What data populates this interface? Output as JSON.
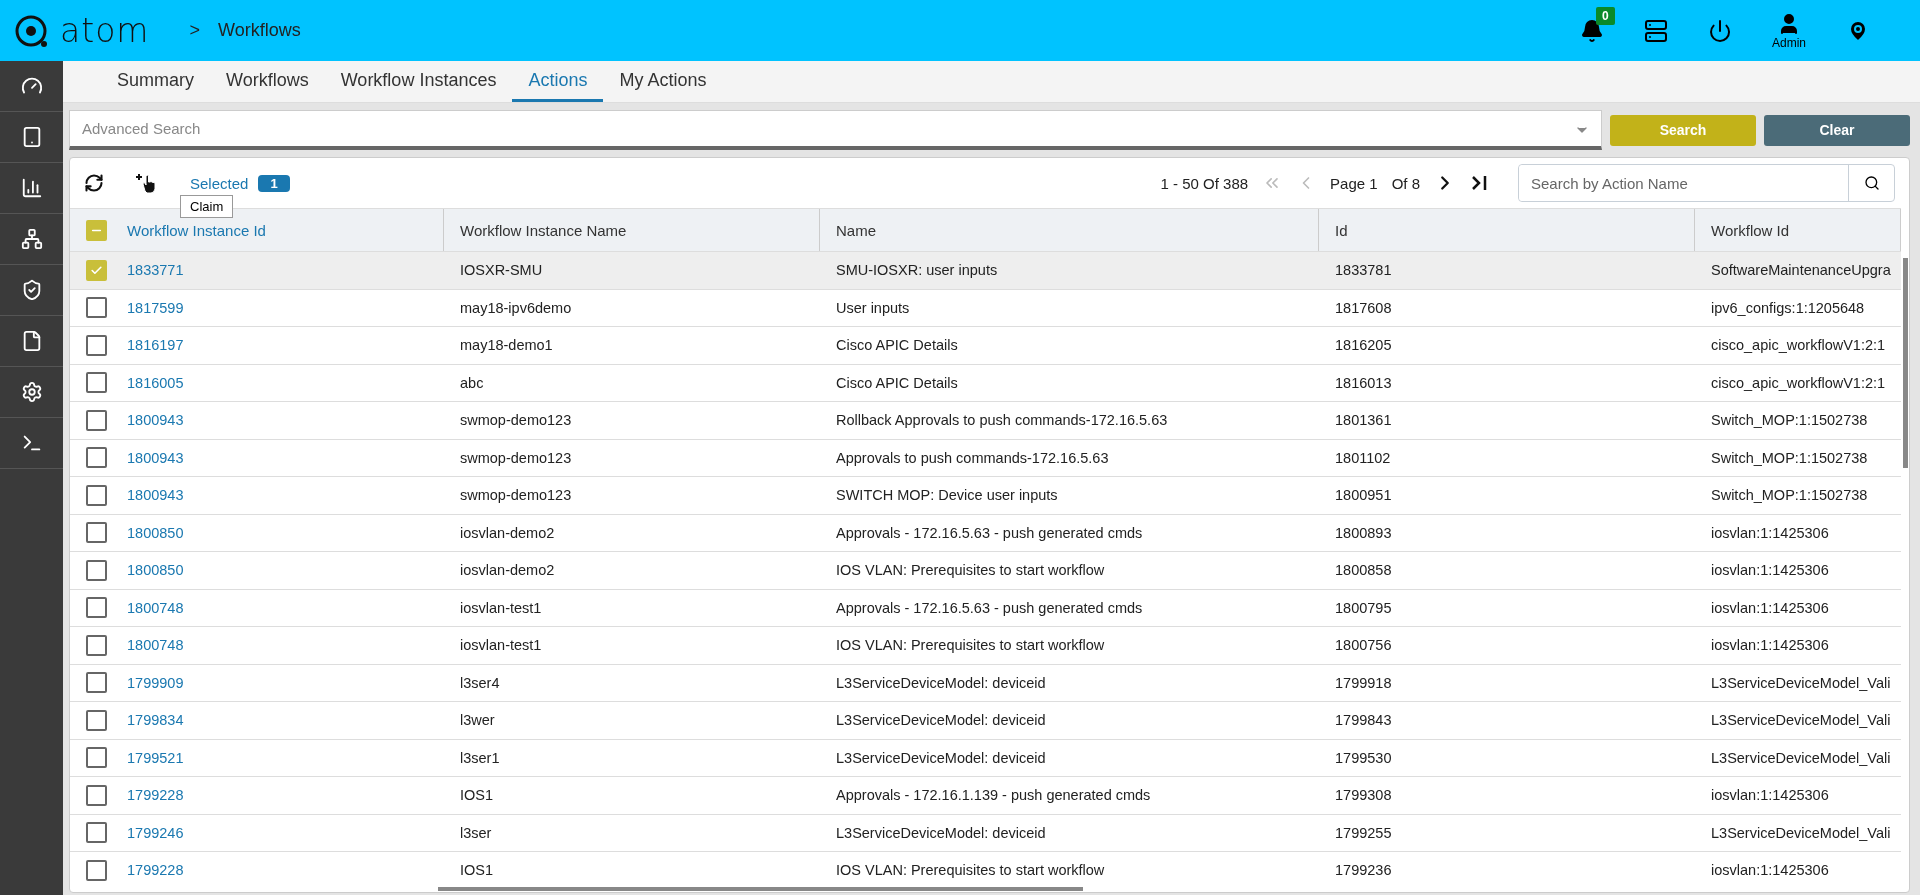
{
  "header": {
    "logo": "atom",
    "breadcrumb_separator": ">",
    "breadcrumb": "Workflows",
    "notifications": "0",
    "user": "Admin"
  },
  "sidebar": {
    "items": [
      {
        "kind": "dashboard",
        "selected": false
      },
      {
        "kind": "devices",
        "selected": false
      },
      {
        "kind": "charts",
        "selected": false
      },
      {
        "kind": "network",
        "selected": false
      },
      {
        "kind": "shield",
        "selected": false
      },
      {
        "kind": "file",
        "selected": false
      },
      {
        "kind": "settings",
        "selected": false
      },
      {
        "kind": "terminal",
        "selected": false
      }
    ]
  },
  "tabs": [
    {
      "label": "Summary",
      "selected": false
    },
    {
      "label": "Workflows",
      "selected": false
    },
    {
      "label": "Workflow Instances",
      "selected": false
    },
    {
      "label": "Actions",
      "selected": true
    },
    {
      "label": "My Actions",
      "selected": false
    }
  ],
  "advanced_search": {
    "placeholder": "Advanced Search"
  },
  "buttons": [
    {
      "label": "Search",
      "kind": "primary"
    },
    {
      "label": "Clear",
      "kind": "secondary"
    }
  ],
  "toolbar": {
    "selected_label": "Selected",
    "selected_count": "1",
    "tooltip": "Claim",
    "range": "1 - 50 Of 388",
    "page": "Page 1",
    "of_pages": "Of 8",
    "search_placeholder": "Search by Action Name"
  },
  "table": {
    "select_all_partial": true,
    "columns": [
      "Workflow Instance Id",
      "Workflow Instance Name",
      "Name",
      "Id",
      "Workflow Id"
    ],
    "rows": [
      {
        "selected": true,
        "cells": [
          "1833771",
          "IOSXR-SMU",
          "SMU-IOSXR: user inputs",
          "1833781",
          "SoftwareMaintenanceUpgra"
        ]
      },
      {
        "selected": false,
        "cells": [
          "1817599",
          "may18-ipv6demo",
          "User inputs",
          "1817608",
          "ipv6_configs:1:1205648"
        ]
      },
      {
        "selected": false,
        "cells": [
          "1816197",
          "may18-demo1",
          "Cisco APIC Details",
          "1816205",
          "cisco_apic_workflowV1:2:1"
        ]
      },
      {
        "selected": false,
        "cells": [
          "1816005",
          "abc",
          "Cisco APIC Details",
          "1816013",
          "cisco_apic_workflowV1:2:1"
        ]
      },
      {
        "selected": false,
        "cells": [
          "1800943",
          "swmop-demo123",
          "Rollback Approvals to push commands-172.16.5.63",
          "1801361",
          "Switch_MOP:1:1502738"
        ]
      },
      {
        "selected": false,
        "cells": [
          "1800943",
          "swmop-demo123",
          "Approvals to push commands-172.16.5.63",
          "1801102",
          "Switch_MOP:1:1502738"
        ]
      },
      {
        "selected": false,
        "cells": [
          "1800943",
          "swmop-demo123",
          "SWITCH MOP: Device user inputs",
          "1800951",
          "Switch_MOP:1:1502738"
        ]
      },
      {
        "selected": false,
        "cells": [
          "1800850",
          "iosvlan-demo2",
          "Approvals - 172.16.5.63 - push generated cmds",
          "1800893",
          "iosvlan:1:1425306"
        ]
      },
      {
        "selected": false,
        "cells": [
          "1800850",
          "iosvlan-demo2",
          "IOS VLAN: Prerequisites to start workflow",
          "1800858",
          "iosvlan:1:1425306"
        ]
      },
      {
        "selected": false,
        "cells": [
          "1800748",
          "iosvlan-test1",
          "Approvals - 172.16.5.63 - push generated cmds",
          "1800795",
          "iosvlan:1:1425306"
        ]
      },
      {
        "selected": false,
        "cells": [
          "1800748",
          "iosvlan-test1",
          "IOS VLAN: Prerequisites to start workflow",
          "1800756",
          "iosvlan:1:1425306"
        ]
      },
      {
        "selected": false,
        "cells": [
          "1799909",
          "l3ser4",
          "L3ServiceDeviceModel: deviceid",
          "1799918",
          "L3ServiceDeviceModel_Vali"
        ]
      },
      {
        "selected": false,
        "cells": [
          "1799834",
          "l3wer",
          "L3ServiceDeviceModel: deviceid",
          "1799843",
          "L3ServiceDeviceModel_Vali"
        ]
      },
      {
        "selected": false,
        "cells": [
          "1799521",
          "l3ser1",
          "L3ServiceDeviceModel: deviceid",
          "1799530",
          "L3ServiceDeviceModel_Vali"
        ]
      },
      {
        "selected": false,
        "cells": [
          "1799228",
          "IOS1",
          "Approvals - 172.16.1.139 - push generated cmds",
          "1799308",
          "iosvlan:1:1425306"
        ]
      },
      {
        "selected": false,
        "cells": [
          "1799246",
          "l3ser",
          "L3ServiceDeviceModel: deviceid",
          "1799255",
          "L3ServiceDeviceModel_Vali"
        ]
      },
      {
        "selected": false,
        "cells": [
          "1799228",
          "IOS1",
          "IOS VLAN: Prerequisites to start workflow",
          "1799236",
          "iosvlan:1:1425306"
        ]
      }
    ]
  }
}
